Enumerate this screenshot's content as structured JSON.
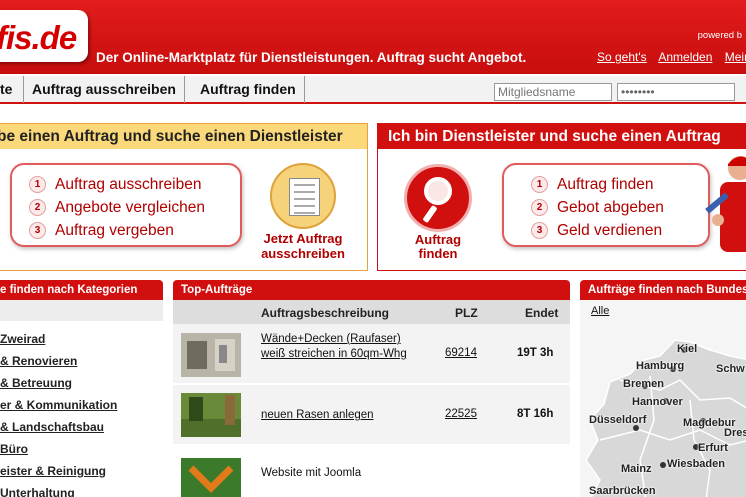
{
  "header": {
    "logo": "fis.de",
    "slogan": "Der Online-Marktplatz für Dienstleistungen. Auftrag sucht Angebot.",
    "powered": "powered b",
    "links": [
      "So geht's",
      "Anmelden",
      "Mein"
    ]
  },
  "nav": {
    "items": [
      "te",
      "Auftrag ausschreiben",
      "Auftrag finden"
    ],
    "member_placeholder": "Mitgliedsname",
    "password_value": "********"
  },
  "promo_left": {
    "title": "be einen Auftrag und suche einen Dienstleister",
    "steps": [
      {
        "num": "1",
        "label": "Auftrag ausschreiben"
      },
      {
        "num": "2",
        "label": "Angebote vergleichen"
      },
      {
        "num": "3",
        "label": "Auftrag vergeben"
      }
    ],
    "cta": "Jetzt Auftrag ausschreiben",
    "icon": "document-icon"
  },
  "promo_right": {
    "title": "Ich bin Dienstleister und suche einen Auftrag",
    "steps": [
      {
        "num": "1",
        "label": "Auftrag finden"
      },
      {
        "num": "2",
        "label": "Gebot abgeben"
      },
      {
        "num": "3",
        "label": "Geld verdienen"
      }
    ],
    "cta": "Auftrag finden",
    "icon": "magnifier-icon"
  },
  "categories": {
    "heading": "e finden nach Kategorien",
    "items": [
      "Zweirad",
      "& Renovieren",
      "& Betreuung",
      "er & Kommunikation",
      "& Landschaftsbau",
      "Büro",
      "eister & Reinigung",
      "Unterhaltung"
    ]
  },
  "top_auftraege": {
    "heading": "Top-Aufträge",
    "columns": [
      "Auftragsbeschreibung",
      "PLZ",
      "Endet"
    ],
    "rows": [
      {
        "desc": "Wände+Decken (Raufaser) weiß streichen in 60qm-Whg",
        "plz": "69214",
        "endet": "19T 3h"
      },
      {
        "desc": "neuen Rasen anlegen",
        "plz": "22525",
        "endet": "8T 16h"
      },
      {
        "desc": "Website mit Joomla",
        "plz": "",
        "endet": ""
      }
    ]
  },
  "bundesland": {
    "heading": "Aufträge finden nach Bundes",
    "all_link": "Alle",
    "cities": [
      "Kiel",
      "Hamburg",
      "Schw",
      "Bremen",
      "Hannover",
      "Düsseldorf",
      "Magdebur",
      "Erfurt",
      "Dres",
      "Wiesbaden",
      "Mainz",
      "Saarbrücken"
    ]
  },
  "colors": {
    "brand_red": "#d20f0f",
    "promo_yellow": "#fbd97a",
    "link_red": "#b00000"
  }
}
